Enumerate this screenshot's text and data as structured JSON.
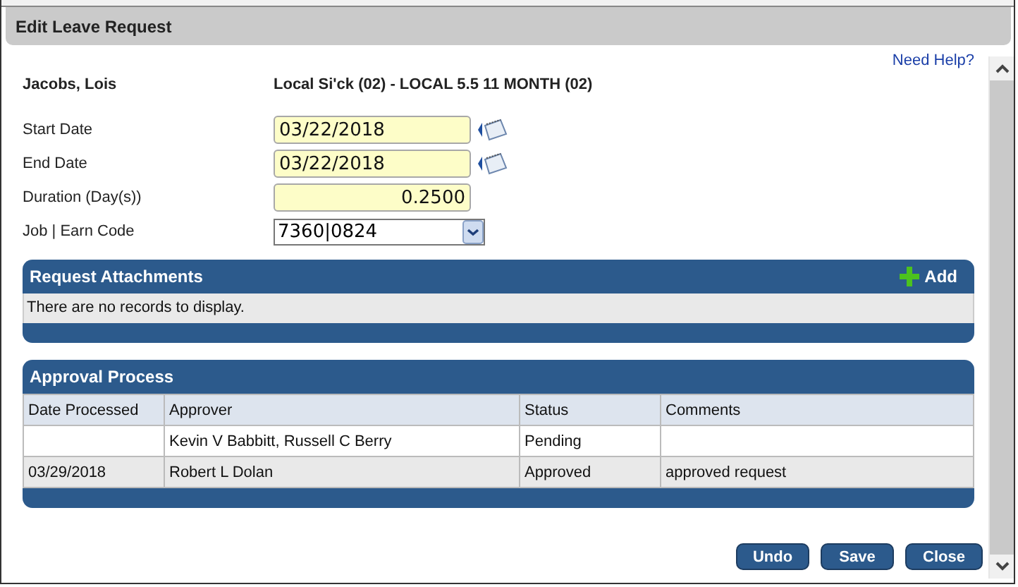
{
  "dialog": {
    "title": "Edit Leave Request",
    "help_link": "Need Help?"
  },
  "employee": {
    "name": "Jacobs, Lois",
    "leave_type": "Local Si'ck (02) - LOCAL 5.5 11 MONTH (02)"
  },
  "fields": [
    {
      "label": "Start Date",
      "value": "03/22/2018",
      "kind": "date"
    },
    {
      "label": "End Date",
      "value": "03/22/2018",
      "kind": "date"
    },
    {
      "label": "Duration (Day(s))",
      "value": "0.2500",
      "kind": "number"
    },
    {
      "label": "Job | Earn Code",
      "value": "7360|0824",
      "kind": "select"
    }
  ],
  "attachments": {
    "title": "Request Attachments",
    "add_button": "Add",
    "empty_message": "There are no records to display."
  },
  "approval": {
    "title": "Approval Process",
    "columns": [
      "Date Processed",
      "Approver",
      "Status",
      "Comments"
    ],
    "rows": [
      [
        "",
        "Kevin V Babbitt, Russell C Berry",
        "Pending",
        ""
      ],
      [
        "03/29/2018",
        "Robert L Dolan",
        "Approved",
        "approved request"
      ]
    ]
  },
  "buttons": [
    "Undo",
    "Save",
    "Close"
  ]
}
